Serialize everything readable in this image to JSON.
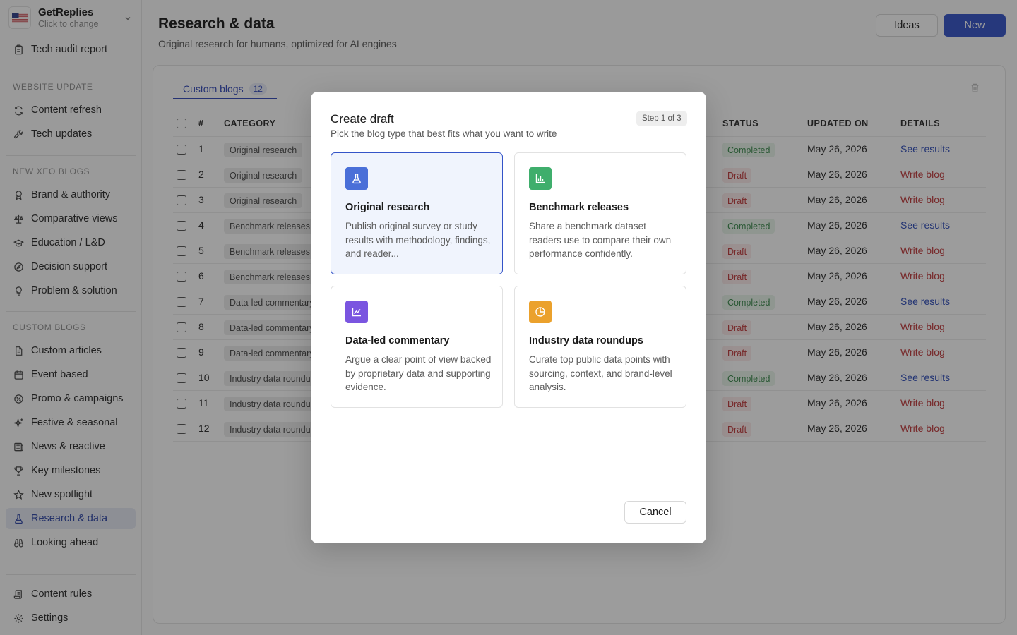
{
  "brand": {
    "name": "GetReplies",
    "subtitle": "Click to change"
  },
  "sidebar": {
    "top_item": {
      "label": "Tech audit report",
      "icon": "clipboard-icon"
    },
    "sections": [
      {
        "title": "WEBSITE UPDATE",
        "items": [
          {
            "label": "Content refresh",
            "icon": "refresh-icon"
          },
          {
            "label": "Tech updates",
            "icon": "wrench-icon"
          }
        ]
      },
      {
        "title": "NEW XEO BLOGS",
        "items": [
          {
            "label": "Brand & authority",
            "icon": "award-icon"
          },
          {
            "label": "Comparative views",
            "icon": "scale-icon"
          },
          {
            "label": "Education / L&D",
            "icon": "graduation-cap-icon"
          },
          {
            "label": "Decision support",
            "icon": "compass-icon"
          },
          {
            "label": "Problem & solution",
            "icon": "lightbulb-icon"
          }
        ]
      },
      {
        "title": "CUSTOM BLOGS",
        "items": [
          {
            "label": "Custom articles",
            "icon": "document-icon"
          },
          {
            "label": "Event based",
            "icon": "calendar-icon"
          },
          {
            "label": "Promo & campaigns",
            "icon": "percent-badge-icon"
          },
          {
            "label": "Festive & seasonal",
            "icon": "sparkle-icon"
          },
          {
            "label": "News & reactive",
            "icon": "newspaper-icon"
          },
          {
            "label": "Key milestones",
            "icon": "trophy-icon"
          },
          {
            "label": "New spotlight",
            "icon": "star-icon"
          },
          {
            "label": "Research & data",
            "icon": "flask-icon",
            "active": true
          },
          {
            "label": "Looking ahead",
            "icon": "binoculars-icon"
          }
        ]
      }
    ],
    "bottom": [
      {
        "label": "Content rules",
        "icon": "scroll-icon"
      },
      {
        "label": "Settings",
        "icon": "gear-icon"
      }
    ]
  },
  "header": {
    "title": "Research & data",
    "subtitle": "Original research for humans, optimized for AI engines",
    "ideas_label": "Ideas",
    "new_label": "New"
  },
  "tabs": [
    {
      "label": "Custom blogs",
      "count": "12"
    }
  ],
  "table": {
    "columns": {
      "num": "#",
      "category": "CATEGORY",
      "status": "STATUS",
      "updated": "UPDATED ON",
      "details": "DETAILS"
    },
    "rows": [
      {
        "num": "1",
        "category": "Original research",
        "status": "Completed",
        "updated": "May 26, 2026",
        "details": "See results"
      },
      {
        "num": "2",
        "category": "Original research",
        "status": "Draft",
        "updated": "May 26, 2026",
        "details": "Write blog"
      },
      {
        "num": "3",
        "category": "Original research",
        "status": "Draft",
        "updated": "May 26, 2026",
        "details": "Write blog"
      },
      {
        "num": "4",
        "category": "Benchmark releases",
        "status": "Completed",
        "updated": "May 26, 2026",
        "details": "See results"
      },
      {
        "num": "5",
        "category": "Benchmark releases",
        "status": "Draft",
        "updated": "May 26, 2026",
        "details": "Write blog"
      },
      {
        "num": "6",
        "category": "Benchmark releases",
        "status": "Draft",
        "updated": "May 26, 2026",
        "details": "Write blog"
      },
      {
        "num": "7",
        "category": "Data-led commentary",
        "status": "Completed",
        "updated": "May 26, 2026",
        "details": "See results"
      },
      {
        "num": "8",
        "category": "Data-led commentary",
        "status": "Draft",
        "updated": "May 26, 2026",
        "details": "Write blog"
      },
      {
        "num": "9",
        "category": "Data-led commentary",
        "status": "Draft",
        "updated": "May 26, 2026",
        "details": "Write blog"
      },
      {
        "num": "10",
        "category": "Industry data roundups",
        "status": "Completed",
        "updated": "May 26, 2026",
        "details": "See results"
      },
      {
        "num": "11",
        "category": "Industry data roundups",
        "status": "Draft",
        "updated": "May 26, 2026",
        "details": "Write blog"
      },
      {
        "num": "12",
        "category": "Industry data roundups",
        "status": "Draft",
        "updated": "May 26, 2026",
        "details": "Write blog"
      }
    ]
  },
  "modal": {
    "title": "Create draft",
    "subtitle": "Pick the blog type that best fits what you want to write",
    "step": "Step 1 of 3",
    "cards": [
      {
        "title": "Original research",
        "description": "Publish original survey or study results with methodology, findings, and reader...",
        "icon": "flask-icon",
        "color": "#4a6fd8",
        "selected": true
      },
      {
        "title": "Benchmark releases",
        "description": "Share a benchmark dataset readers use to compare their own performance confidently.",
        "icon": "bar-chart-icon",
        "color": "#3fae6c"
      },
      {
        "title": "Data-led commentary",
        "description": "Argue a clear point of view backed by proprietary data and supporting evidence.",
        "icon": "line-chart-icon",
        "color": "#7a55e0"
      },
      {
        "title": "Industry data roundups",
        "description": "Curate top public data points with sourcing, context, and brand-level analysis.",
        "icon": "pie-chart-icon",
        "color": "#eba12c"
      }
    ],
    "cancel_label": "Cancel"
  },
  "colors": {
    "accent": "#3454c8",
    "completed": "#3b8a4d",
    "draft": "#c0393b"
  }
}
